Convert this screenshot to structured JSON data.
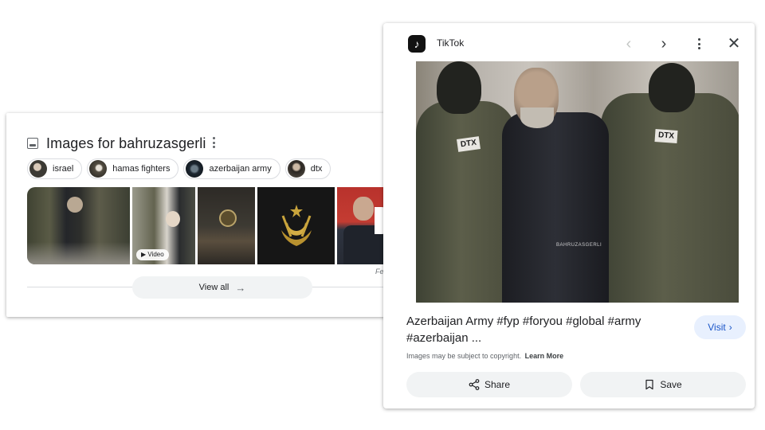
{
  "images_panel": {
    "title": "Images for bahruzasgerli",
    "chips": [
      {
        "label": "israel"
      },
      {
        "label": "hamas fighters"
      },
      {
        "label": "azerbaijan army"
      },
      {
        "label": "dtx"
      }
    ],
    "video_badge": "Video",
    "feedback_fragment": "Fe",
    "view_all_label": "View all",
    "view_all_arrow": "→"
  },
  "preview": {
    "source_name": "TikTok",
    "logo_glyph": "♪",
    "prev_glyph": "‹",
    "next_glyph": "›",
    "close_glyph": "✕",
    "patch_left": "DTX",
    "patch_right": "DTX",
    "watermark": "BAHRUZASGERLI",
    "title": "Azerbaijan Army #fyp #foryou #global #army #azerbaijan ...",
    "visit_label": "Visit",
    "visit_chevron": "›",
    "copyright_text": "Images may be subject to copyright.",
    "learn_more": "Learn More",
    "share_label": "Share",
    "save_label": "Save",
    "colors": {
      "visit_bg": "#e8f0fe",
      "visit_text": "#1a55c8",
      "button_bg": "#f1f3f4"
    }
  }
}
